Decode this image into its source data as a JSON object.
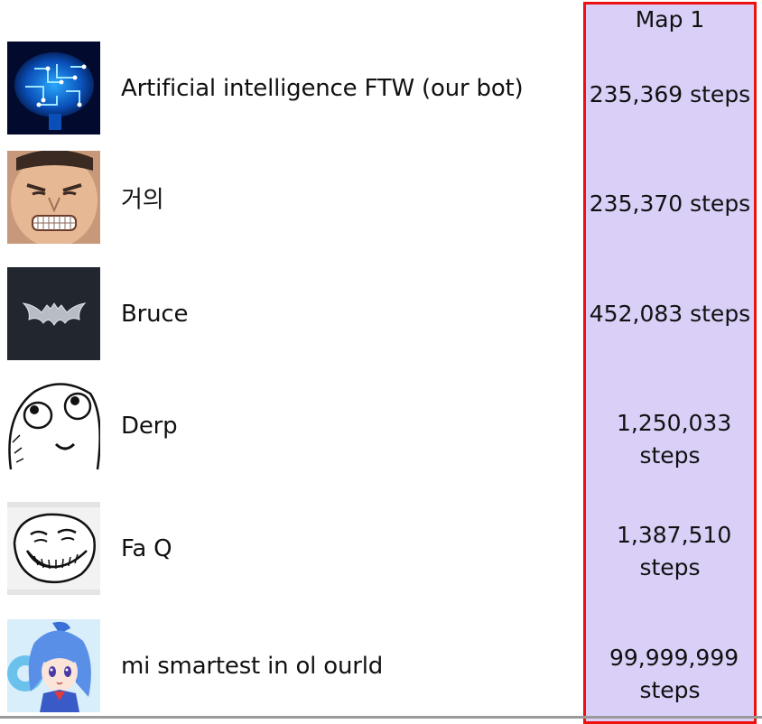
{
  "header": {
    "map_label": "Map 1"
  },
  "players": [
    {
      "name": "Artificial intelligence FTW (our bot)",
      "steps": "235,369 steps",
      "avatar_icon": "brain-circuit-icon"
    },
    {
      "name": "거의",
      "steps": "235,370 steps",
      "avatar_icon": "grimacing-face-icon"
    },
    {
      "name": "Bruce",
      "steps": "452,083 steps",
      "avatar_icon": "bat-emblem-icon"
    },
    {
      "name": "Derp",
      "steps": "1,250,033 steps",
      "avatar_icon": "derp-face-icon"
    },
    {
      "name": "Fa Q",
      "steps": "1,387,510 steps",
      "avatar_icon": "trollface-icon"
    },
    {
      "name": "mi smartest in ol ourld",
      "steps": "99,999,999 steps",
      "avatar_icon": "anime-girl-icon"
    }
  ],
  "colors": {
    "score_column_bg": "#d9cff7",
    "score_column_border": "#ee1111"
  }
}
